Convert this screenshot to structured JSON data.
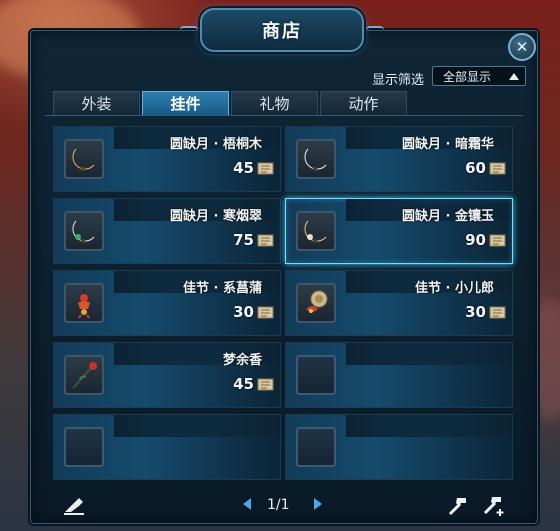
{
  "window": {
    "title": "商店",
    "close_symbol": "✕"
  },
  "filter": {
    "label": "显示筛选",
    "selected": "全部显示"
  },
  "tabs": [
    {
      "label": "外装",
      "active": false
    },
    {
      "label": "挂件",
      "active": true
    },
    {
      "label": "礼物",
      "active": false
    },
    {
      "label": "动作",
      "active": false
    }
  ],
  "items": [
    {
      "name": "圆缺月 · 梧桐木",
      "price": "45",
      "icon": "crescent-moon-ornament-gold-icon",
      "selected": false
    },
    {
      "name": "圆缺月 · 暗霜华",
      "price": "60",
      "icon": "crescent-moon-ornament-silver-icon",
      "selected": false
    },
    {
      "name": "圆缺月 · 寒烟翠",
      "price": "75",
      "icon": "crescent-moon-ornament-jade-icon",
      "selected": false
    },
    {
      "name": "圆缺月 · 金镶玉",
      "price": "90",
      "icon": "crescent-moon-ornament-gold-jade-icon",
      "selected": true
    },
    {
      "name": "佳节 · 系菖蒲",
      "price": "30",
      "icon": "calamus-charm-icon",
      "selected": false
    },
    {
      "name": "佳节 · 小儿郎",
      "price": "30",
      "icon": "child-charm-icon",
      "selected": false
    },
    {
      "name": "梦余香",
      "price": "45",
      "icon": "red-flower-branch-icon",
      "selected": false
    },
    {
      "name": "",
      "price": "",
      "icon": "",
      "selected": false
    },
    {
      "name": "",
      "price": "",
      "icon": "",
      "selected": false
    },
    {
      "name": "",
      "price": "",
      "icon": "",
      "selected": false
    }
  ],
  "pagination": {
    "text": "1/1"
  },
  "footer": {
    "left_icon": "unequip-icon",
    "right_icons": [
      "hammer-icon",
      "hammer-plus-icon"
    ]
  },
  "currency_icon": "coupon-scroll-icon",
  "colors": {
    "accent": "#2f7fb0",
    "selected_glow": "#43c6ff",
    "panel": "#0f2636"
  }
}
